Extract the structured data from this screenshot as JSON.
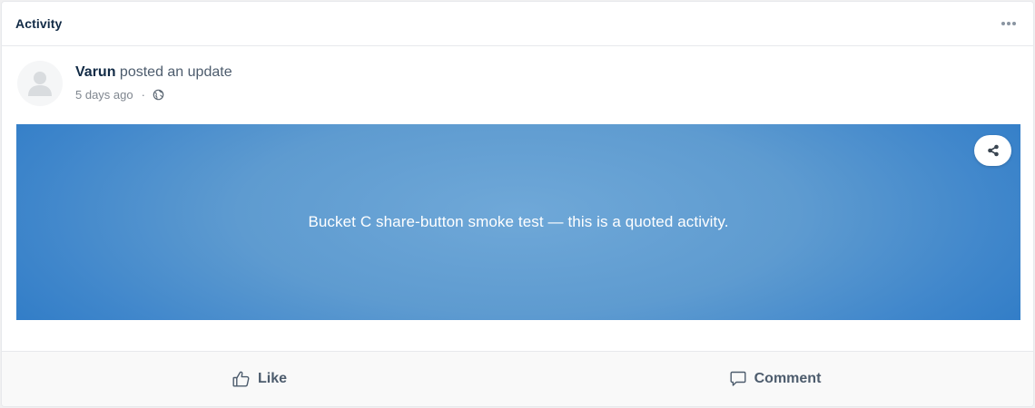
{
  "card": {
    "title": "Activity",
    "more_icon": "more-horizontal-icon"
  },
  "post": {
    "author": "Varun",
    "action_text": "posted an update",
    "time_ago": "5 days ago",
    "separator": "·",
    "avatar_icon": "default-user-icon",
    "privacy_icon": "globe-icon"
  },
  "banner": {
    "text": "Bucket C share-button smoke test — this is a quoted activity.",
    "share_icon": "share-icon",
    "colors": {
      "center": "#6fa8d8",
      "edge": "#2d7ac6"
    }
  },
  "actions": {
    "like_label": "Like",
    "like_icon": "thumbs-up-icon",
    "comment_label": "Comment",
    "comment_icon": "comment-icon"
  }
}
